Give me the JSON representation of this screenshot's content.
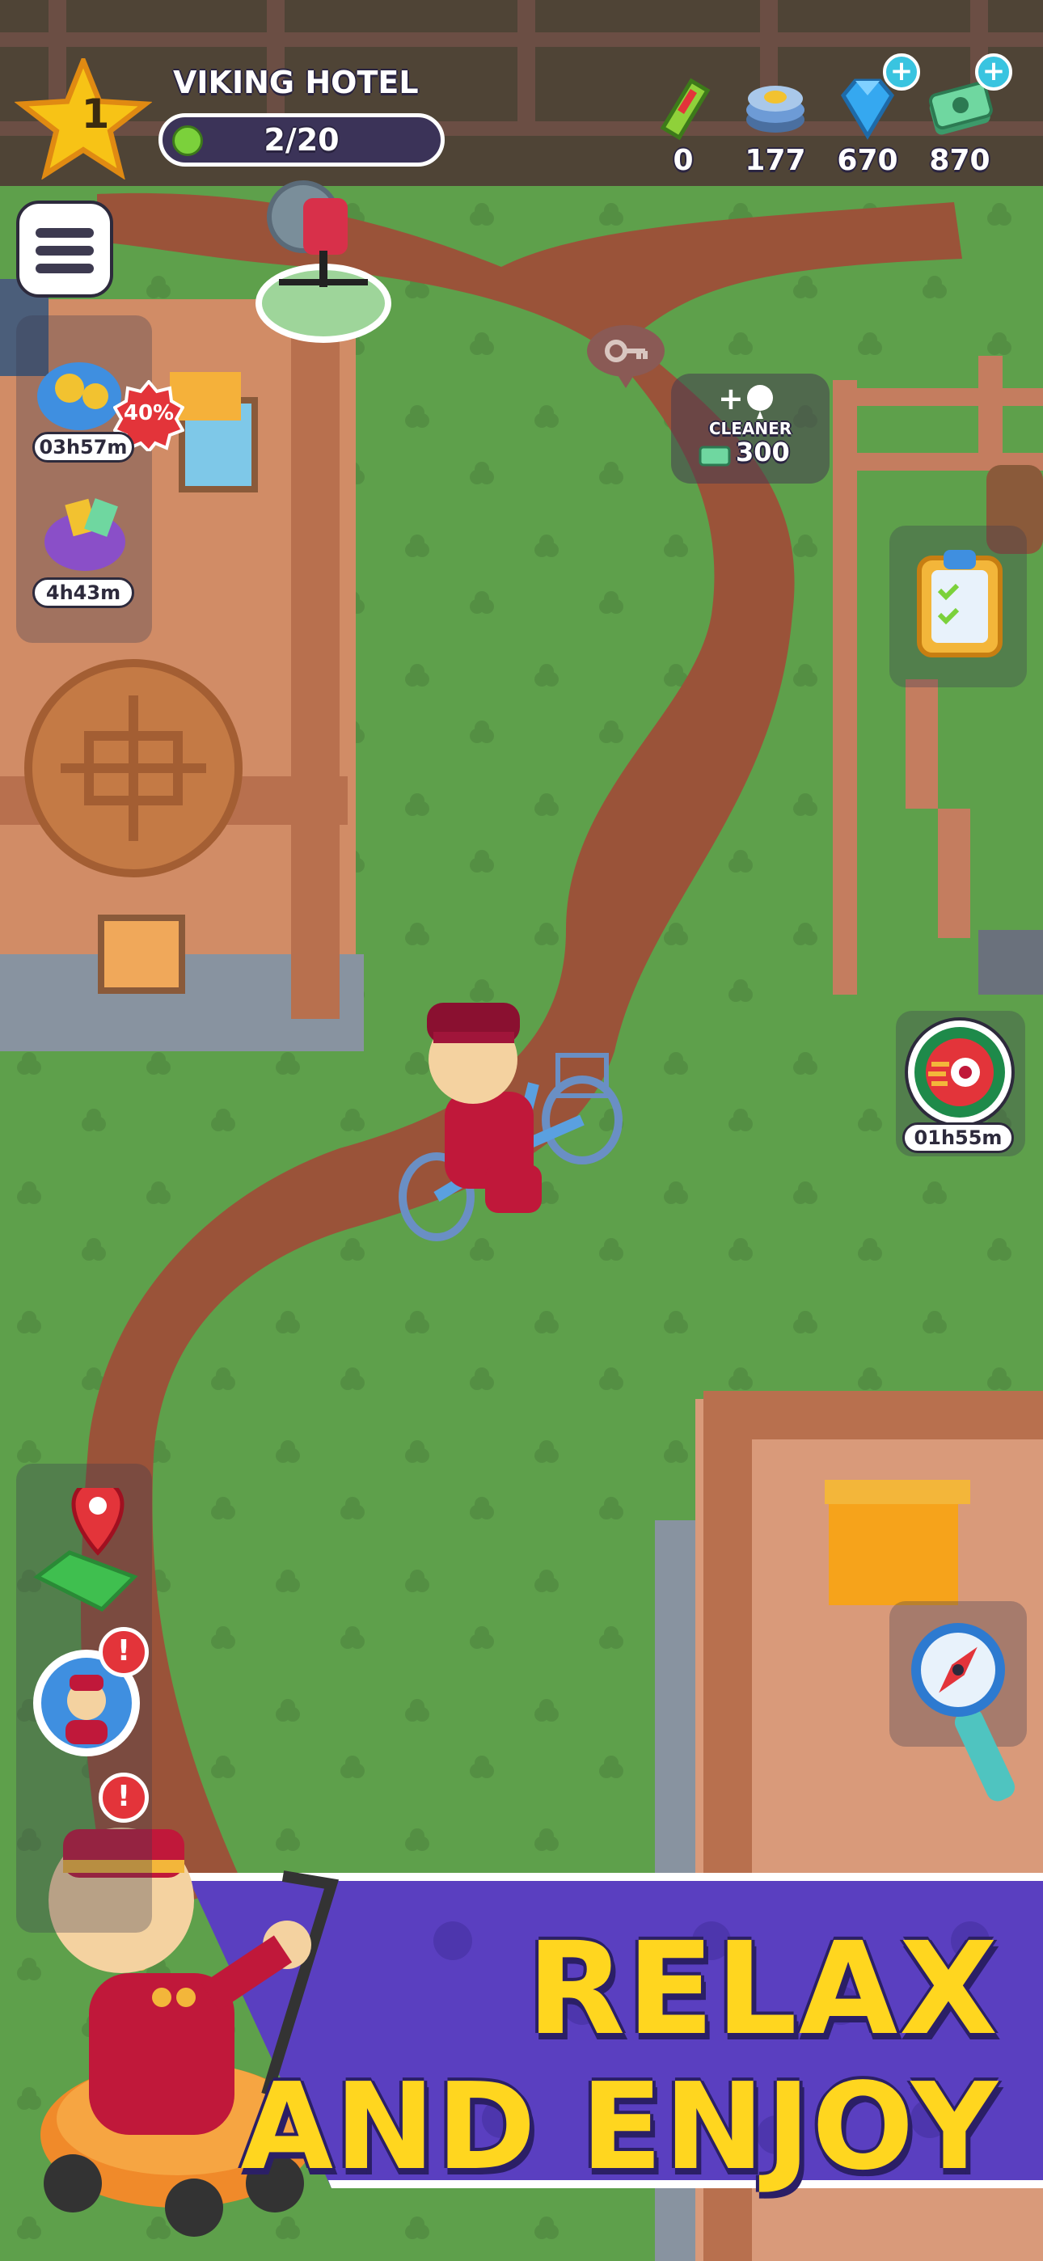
{
  "hud": {
    "level": "1",
    "hotel_name": "VIKING HOTEL",
    "progress_text": "2/20",
    "progress_fraction": 0.1,
    "resources": [
      {
        "name": "ticket",
        "icon": "ticket-icon",
        "value": "0",
        "color": "#8fd13a"
      },
      {
        "name": "coins",
        "icon": "coins-icon",
        "value": "177",
        "color": "#f2c230"
      },
      {
        "name": "gems",
        "icon": "gem-icon",
        "value": "670",
        "color": "#35a8f0"
      },
      {
        "name": "cash",
        "icon": "cash-icon",
        "value": "870",
        "color": "#6fd7a0"
      }
    ],
    "plus_symbol": "+"
  },
  "side_left": {
    "offer_timer": "03h57m",
    "discount_badge": "40%",
    "bag_timer": "4h43m"
  },
  "upgrade_marker": {
    "label": "CLEANER",
    "prefix": "+",
    "cost": "300"
  },
  "side_right": {
    "boost_timer": "01h55m"
  },
  "left_bottom": {
    "alert_symbol": "!"
  },
  "banner": {
    "line1": "RELAX",
    "line2": "AND ENJOY"
  },
  "colors": {
    "grass": "#5ea04b",
    "path": "#9a5339",
    "banner_bg": "#5a3fc0",
    "banner_text": "#ffd61f",
    "bellhop": "#c0183a"
  }
}
